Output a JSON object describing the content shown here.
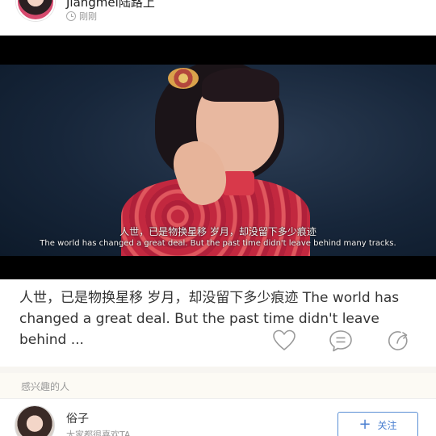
{
  "header": {
    "author": "Jiangmei陆路上",
    "time": "刚刚"
  },
  "video": {
    "subtitle_cn": "人世，已是物换星移 岁月，却没留下多少痕迹",
    "subtitle_en": "The world has changed a great deal. But the past time didn't leave behind many tracks."
  },
  "post": {
    "caption": "人世，已是物换星移 岁月，却没留下多少痕迹 The world has changed a great deal. But the past time didn't leave behind ..."
  },
  "actions": {
    "icons": [
      "heart-icon",
      "comment-icon",
      "share-icon"
    ]
  },
  "recommend": {
    "title": "感兴趣的人",
    "user": {
      "name": "俗子",
      "desc": "大家都很喜欢TA",
      "follow_label": "关注"
    }
  },
  "colors": {
    "accent": "#4a7fd0",
    "icon_gray": "#9a9a9a"
  }
}
